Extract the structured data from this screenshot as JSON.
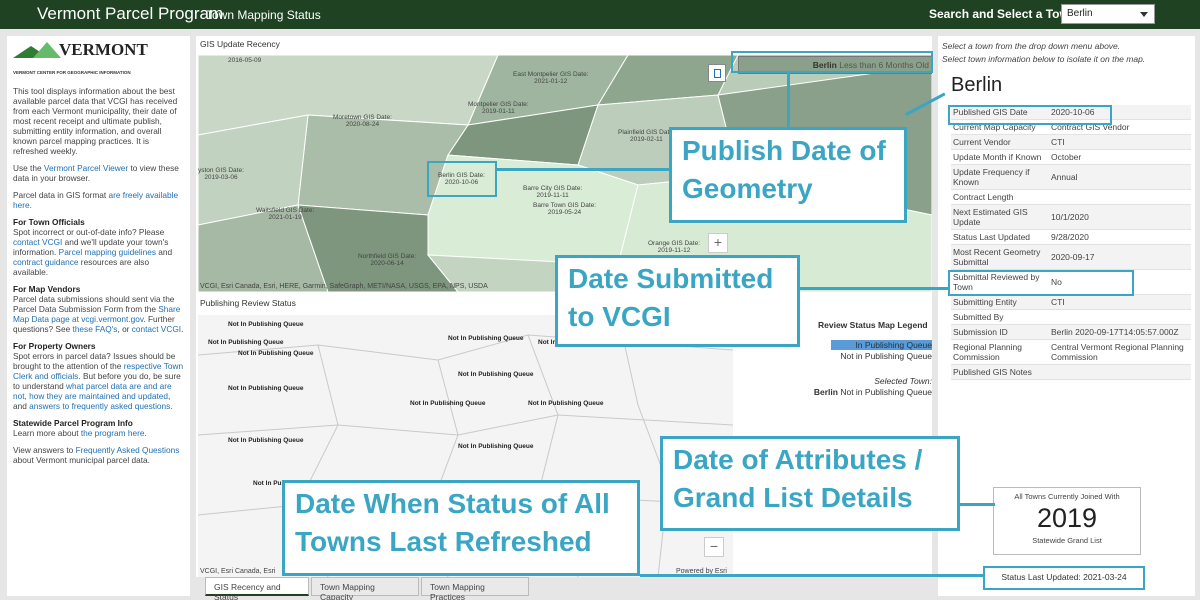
{
  "header": {
    "title": "Vermont Parcel Program",
    "subtitle": "Town Mapping Status",
    "search_label": "Search and Select a Town:",
    "selected_town": "Berlin"
  },
  "left": {
    "logo_name": "VERMONT",
    "logo_sub": "VERMONT CENTER FOR GEOGRAPHIC INFORMATION",
    "intro": "This tool displays information about the best available parcel data that VCGI has received from each Vermont municipality, their date of most recent receipt and ultimate publish, submitting entity information, and overall known parcel mapping practices. It is refreshed weekly.",
    "p_viewer_a": "Use the ",
    "p_viewer_link": "Vermont Parcel Viewer",
    "p_viewer_b": " to view these data in your browser.",
    "p_gis_a": "Parcel data in GIS format ",
    "p_gis_link": "are freely available here",
    "p_gis_b": ".",
    "h_officials": "For Town Officials",
    "off_1": "Spot incorrect or out-of-date info? Please ",
    "off_link1": "contact VCGI",
    "off_2": " and we'll update your town's information. ",
    "off_link2": "Parcel mapping guidelines",
    "off_3": " and ",
    "off_link3": "contract guidance",
    "off_4": " resources are also available.",
    "h_vendors": "For Map Vendors",
    "ven_1": "Parcel data submissions should sent via the Parcel Data Submission Form from the ",
    "ven_link1": "Share Map Data page at vcgi.vermont.gov",
    "ven_2": ". Further questions? See ",
    "ven_link2": "these FAQ's",
    "ven_3": ", or ",
    "ven_link3": "contact VCGI",
    "ven_4": ".",
    "h_owners": "For Property Owners",
    "own_1": "Spot errors in parcel data? Issues should be brought to the attention of the ",
    "own_link1": "respective Town Clerk and officials",
    "own_2": ". But before you do, be sure to understand ",
    "own_link2": "what parcel data are and are not, how they are maintained and updated",
    "own_3": ", and ",
    "own_link3": "answers to frequently asked questions",
    "own_4": ".",
    "h_program": "Statewide Parcel Program Info",
    "prog_1": "Learn more about ",
    "prog_link": "the program here",
    "prog_2": ".",
    "faq_1": "View answers to ",
    "faq_link": "Frequently Asked Questions",
    "faq_2": " about Vermont municipal parcel data."
  },
  "map_recency": {
    "label": "GIS Update Recency",
    "attribution": "VCGI, Esri Canada, Esri, HERE, Garmin, SafeGraph, METI/NASA, USGS, EPA, NPS, USDA",
    "badge_town": "Berlin",
    "badge_status": "Less than 6 Months Old",
    "towns": [
      {
        "name": "2016-05-09",
        "kind": "date"
      },
      {
        "name": "East Montpelier GIS Date:",
        "date": "2021-01-12"
      },
      {
        "name": "Montpelier GIS Date:",
        "date": "2019-01-11"
      },
      {
        "name": "Moretown GIS Date:",
        "date": "2020-08-24"
      },
      {
        "name": "Plainfield GIS Date:",
        "date": "2019-02-11"
      },
      {
        "name": "Berlin GIS Date:",
        "date": "2020-10-06"
      },
      {
        "name": "yston GIS Date:",
        "date": "2019-03-06"
      },
      {
        "name": "Barre City GIS Date:",
        "date": "2019-11-11"
      },
      {
        "name": "Barre Town GIS Date:",
        "date": "2019-05-24"
      },
      {
        "name": "Waitsfield GIS Date:",
        "date": "2021-01-19"
      },
      {
        "name": "Northfield GIS Date:",
        "date": "2020-06-14"
      },
      {
        "name": "Orange GIS Date:",
        "date": "2019-11-12"
      }
    ]
  },
  "map_review": {
    "label": "Publishing Review Status",
    "attribution": "VCGI, Esri Canada, Esri",
    "powered": "Powered by Esri",
    "queue_label": "Not In Publishing Queue",
    "queue_label_alt": "Not in Publishing Queue",
    "legend_title": "Review Status Map Legend",
    "legend_in": "In Publishing Queue",
    "legend_not": "Not in Publishing Queue",
    "selected_label": "Selected Town:",
    "selected_town": "Berlin",
    "selected_status": "Not in Publishing Queue"
  },
  "tabs": [
    {
      "label": "GIS Recency and Status"
    },
    {
      "label": "Town Mapping Capacity"
    },
    {
      "label": "Town Mapping Practices"
    }
  ],
  "right": {
    "hint1": "Select a town from the drop down menu above.",
    "hint2": "Select town information below to isolate it on the map.",
    "town": "Berlin",
    "rows": [
      {
        "k": "Published GIS Date",
        "v": "2020-10-06"
      },
      {
        "k": "Current Map Capacity",
        "v": "Contract GIS Vendor"
      },
      {
        "k": "Current Vendor",
        "v": "CTI"
      },
      {
        "k": "Update Month if Known",
        "v": "October"
      },
      {
        "k": "Update Frequency if Known",
        "v": "Annual"
      },
      {
        "k": "Contract Length",
        "v": ""
      },
      {
        "k": "Next Estimated GIS Update",
        "v": "10/1/2020"
      },
      {
        "k": "Status Last Updated",
        "v": "9/28/2020"
      },
      {
        "k": "Most Recent Geometry Submittal",
        "v": "2020-09-17"
      },
      {
        "k": "Submittal Reviewed by Town",
        "v": "No"
      },
      {
        "k": "Submitting Entity",
        "v": "CTI"
      },
      {
        "k": "Submitted By",
        "v": ""
      },
      {
        "k": "Submission ID",
        "v": "Berlin 2020-09-17T14:05:57.000Z"
      },
      {
        "k": "Regional Planning Commission",
        "v": "Central Vermont Regional Planning Commission"
      },
      {
        "k": "Published GIS Notes",
        "v": ""
      }
    ],
    "stat_label": "All Towns Currently Joined With",
    "stat_value": "2019",
    "stat_foot": "Statewide Grand List",
    "status_updated": "Status Last Updated: 2021-03-24"
  },
  "callouts": {
    "publish": "Publish Date of Geometry",
    "submitted": "Date Submitted to VCGI",
    "attributes": "Date of Attributes / Grand List Details",
    "refreshed": "Date When Status of All Towns Last Refreshed"
  },
  "colors": {
    "header_bg": "#1f4222",
    "callout": "#3aa6c4",
    "link": "#1f6fb5",
    "in_queue": "#5b9bd5"
  }
}
